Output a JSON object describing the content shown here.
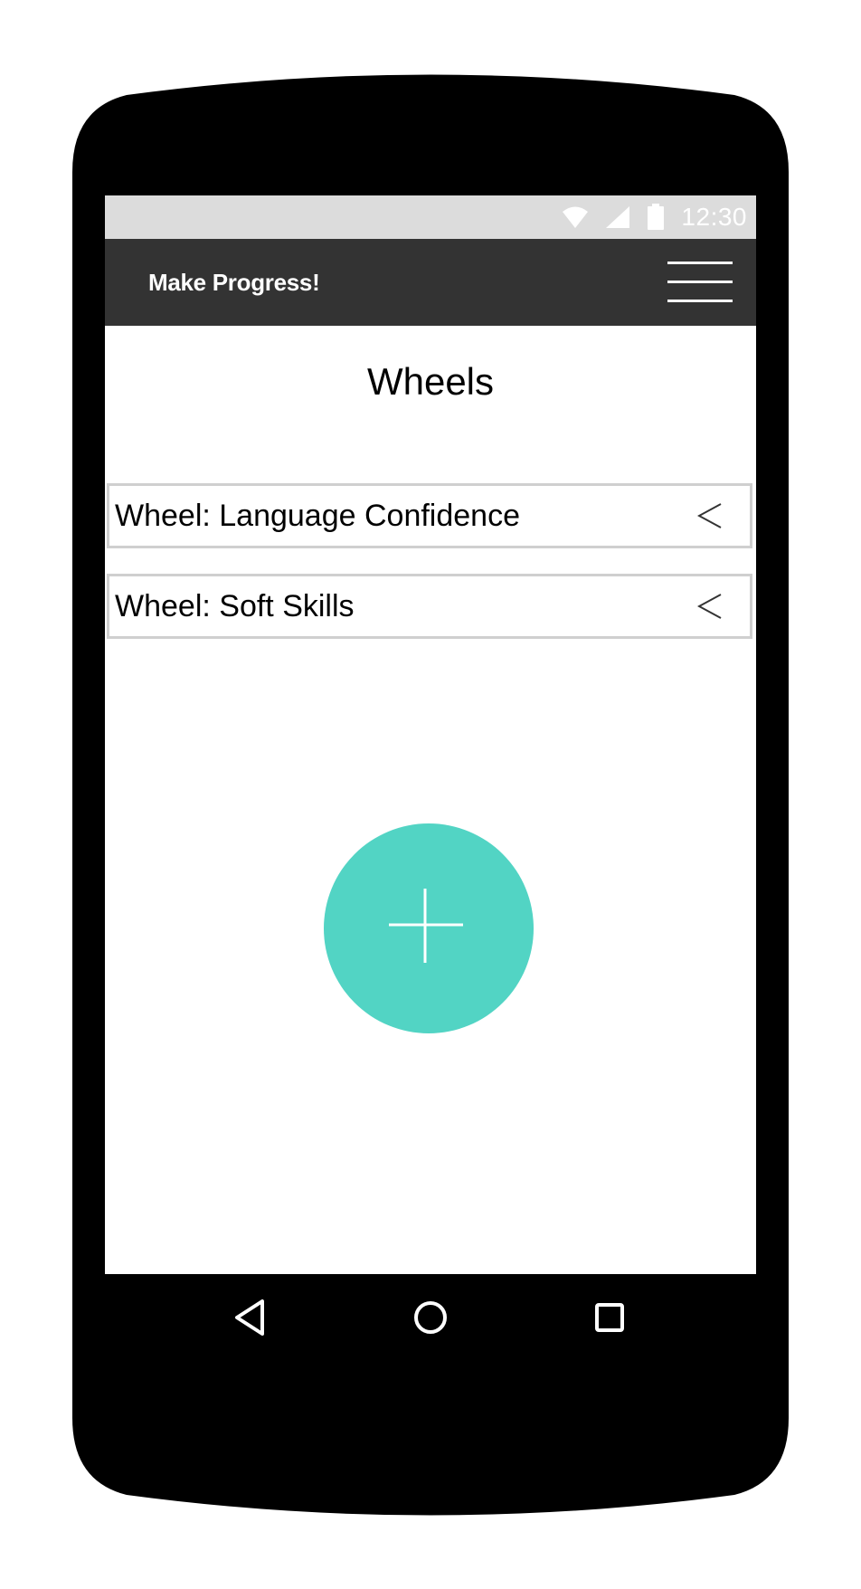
{
  "status_bar": {
    "time": "12:30",
    "icons": [
      "wifi-icon",
      "signal-icon",
      "battery-icon"
    ]
  },
  "app_bar": {
    "title": "Make Progress!",
    "menu_icon": "hamburger-menu-icon"
  },
  "page": {
    "title": "Wheels"
  },
  "wheels": [
    {
      "label": "Wheel: Language Confidence",
      "icon": "chevron-left-icon"
    },
    {
      "label": "Wheel: Soft Skills",
      "icon": "chevron-left-icon"
    }
  ],
  "fab": {
    "icon": "plus-icon"
  },
  "nav_bar": {
    "icons": [
      "back-icon",
      "home-icon",
      "recents-icon"
    ]
  },
  "colors": {
    "phone_body": "#000000",
    "status_bar": "#dcdcdc",
    "app_bar": "#333333",
    "accent": "#52d4c4",
    "item_border": "#cfcfcf"
  }
}
